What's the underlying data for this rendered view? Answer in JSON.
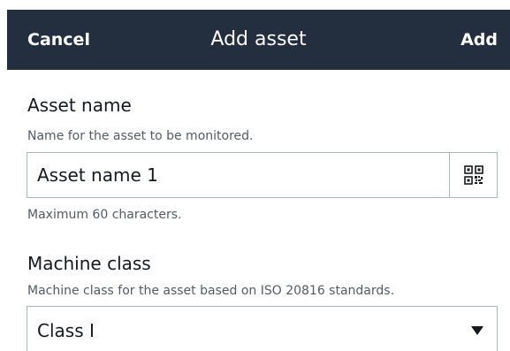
{
  "header": {
    "cancel_label": "Cancel",
    "title": "Add asset",
    "add_label": "Add",
    "background_color": "#232f3e"
  },
  "asset_name": {
    "label": "Asset name",
    "description": "Name for the asset to be monitored.",
    "value": "Asset name 1",
    "scan_icon": "qr-code-icon",
    "constraint": "Maximum 60 characters."
  },
  "machine_class": {
    "label": "Machine class",
    "description": "Machine class for the asset based on ISO 20816 standards.",
    "selected": "Class I",
    "dropdown_icon": "caret-down-icon"
  }
}
